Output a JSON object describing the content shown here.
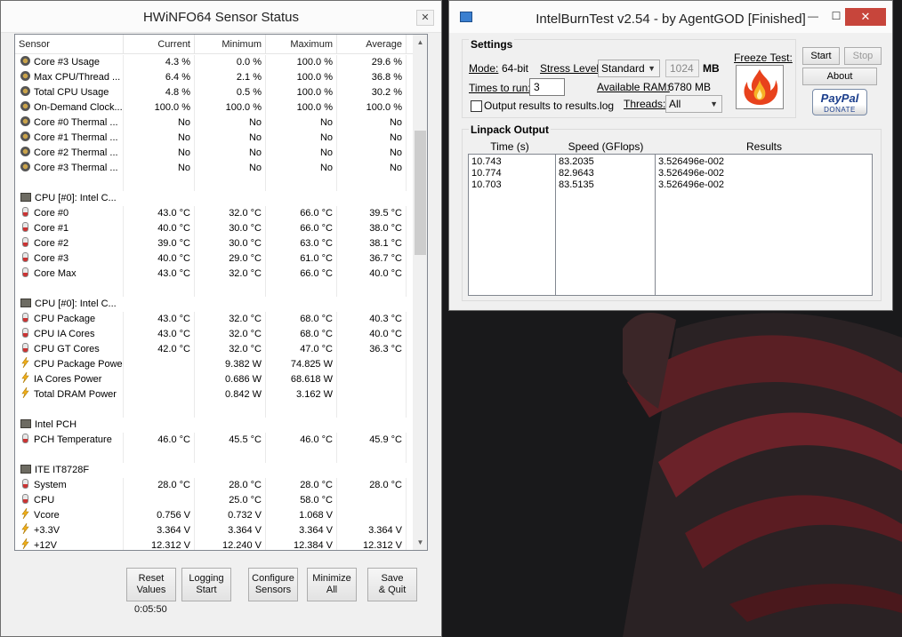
{
  "hwinfo": {
    "title": "HWiNFO64 Sensor Status",
    "close_glyph": "✕",
    "columns": [
      "Sensor",
      "Current",
      "Minimum",
      "Maximum",
      "Average"
    ],
    "rows": [
      {
        "icon": "clock",
        "cells": [
          "Core #3 Usage",
          "4.3 %",
          "0.0 %",
          "100.0 %",
          "29.6 %"
        ]
      },
      {
        "icon": "clock",
        "cells": [
          "Max CPU/Thread ...",
          "6.4 %",
          "2.1 %",
          "100.0 %",
          "36.8 %"
        ]
      },
      {
        "icon": "clock",
        "cells": [
          "Total CPU Usage",
          "4.8 %",
          "0.5 %",
          "100.0 %",
          "30.2 %"
        ]
      },
      {
        "icon": "clock",
        "cells": [
          "On-Demand Clock...",
          "100.0 %",
          "100.0 %",
          "100.0 %",
          "100.0 %"
        ]
      },
      {
        "icon": "clock",
        "cells": [
          "Core #0 Thermal ...",
          "No",
          "No",
          "No",
          "No"
        ]
      },
      {
        "icon": "clock",
        "cells": [
          "Core #1 Thermal ...",
          "No",
          "No",
          "No",
          "No"
        ]
      },
      {
        "icon": "clock",
        "cells": [
          "Core #2 Thermal ...",
          "No",
          "No",
          "No",
          "No"
        ]
      },
      {
        "icon": "clock",
        "cells": [
          "Core #3 Thermal ...",
          "No",
          "No",
          "No",
          "No"
        ]
      },
      {
        "icon": "",
        "cells": [
          "",
          "",
          "",
          "",
          ""
        ]
      },
      {
        "icon": "chip",
        "group": true,
        "cells": [
          "CPU [#0]: Intel C...",
          "",
          "",
          "",
          ""
        ]
      },
      {
        "icon": "therm",
        "cells": [
          "Core #0",
          "43.0 °C",
          "32.0 °C",
          "66.0 °C",
          "39.5 °C"
        ]
      },
      {
        "icon": "therm",
        "cells": [
          "Core #1",
          "40.0 °C",
          "30.0 °C",
          "66.0 °C",
          "38.0 °C"
        ]
      },
      {
        "icon": "therm",
        "cells": [
          "Core #2",
          "39.0 °C",
          "30.0 °C",
          "63.0 °C",
          "38.1 °C"
        ]
      },
      {
        "icon": "therm",
        "cells": [
          "Core #3",
          "40.0 °C",
          "29.0 °C",
          "61.0 °C",
          "36.7 °C"
        ]
      },
      {
        "icon": "therm",
        "cells": [
          "Core Max",
          "43.0 °C",
          "32.0 °C",
          "66.0 °C",
          "40.0 °C"
        ]
      },
      {
        "icon": "",
        "cells": [
          "",
          "",
          "",
          "",
          ""
        ]
      },
      {
        "icon": "chip",
        "group": true,
        "cells": [
          "CPU [#0]: Intel C...",
          "",
          "",
          "",
          ""
        ]
      },
      {
        "icon": "therm",
        "cells": [
          "CPU Package",
          "43.0 °C",
          "32.0 °C",
          "68.0 °C",
          "40.3 °C"
        ]
      },
      {
        "icon": "therm",
        "cells": [
          "CPU IA Cores",
          "43.0 °C",
          "32.0 °C",
          "68.0 °C",
          "40.0 °C"
        ]
      },
      {
        "icon": "therm",
        "cells": [
          "CPU GT Cores",
          "42.0 °C",
          "32.0 °C",
          "47.0 °C",
          "36.3 °C"
        ]
      },
      {
        "icon": "volt",
        "cells": [
          "CPU Package Power",
          "",
          "9.382 W",
          "74.825 W",
          ""
        ]
      },
      {
        "icon": "volt",
        "cells": [
          "IA Cores Power",
          "",
          "0.686 W",
          "68.618 W",
          ""
        ]
      },
      {
        "icon": "volt",
        "cells": [
          "Total DRAM Power",
          "",
          "0.842 W",
          "3.162 W",
          ""
        ]
      },
      {
        "icon": "",
        "cells": [
          "",
          "",
          "",
          "",
          ""
        ]
      },
      {
        "icon": "chip",
        "group": true,
        "cells": [
          "Intel PCH",
          "",
          "",
          "",
          ""
        ]
      },
      {
        "icon": "therm",
        "cells": [
          "PCH Temperature",
          "46.0 °C",
          "45.5 °C",
          "46.0 °C",
          "45.9 °C"
        ]
      },
      {
        "icon": "",
        "cells": [
          "",
          "",
          "",
          "",
          ""
        ]
      },
      {
        "icon": "chip",
        "group": true,
        "cells": [
          "ITE IT8728F",
          "",
          "",
          "",
          ""
        ]
      },
      {
        "icon": "therm",
        "cells": [
          "System",
          "28.0 °C",
          "28.0 °C",
          "28.0 °C",
          "28.0 °C"
        ]
      },
      {
        "icon": "therm",
        "cells": [
          "CPU",
          "",
          "25.0 °C",
          "58.0 °C",
          ""
        ]
      },
      {
        "icon": "volt",
        "cells": [
          "Vcore",
          "0.756 V",
          "0.732 V",
          "1.068 V",
          ""
        ]
      },
      {
        "icon": "volt",
        "cells": [
          "+3.3V",
          "3.364 V",
          "3.364 V",
          "3.364 V",
          "3.364 V"
        ]
      },
      {
        "icon": "volt",
        "cells": [
          "+12V",
          "12.312 V",
          "12.240 V",
          "12.384 V",
          "12.312 V"
        ]
      }
    ],
    "scroll_up_glyph": "▲",
    "scroll_down_glyph": "▼",
    "buttons": [
      {
        "line1": "Reset",
        "line2": "Values"
      },
      {
        "line1": "Logging",
        "line2": "Start"
      },
      {
        "line1": "Configure",
        "line2": "Sensors"
      },
      {
        "line1": "Minimize",
        "line2": "All"
      },
      {
        "line1": "Save",
        "line2": "& Quit"
      }
    ],
    "elapsed": "0:05:50"
  },
  "ibt": {
    "title": "IntelBurnTest v2.54 - by AgentGOD [Finished]",
    "min_glyph": "—",
    "max_glyph": "☐",
    "close_glyph": "✕",
    "settings": {
      "group_label": "Settings",
      "mode_label": "Mode:",
      "mode_value": "64-bit",
      "stress_label": "Stress Level:",
      "stress_value": "Standard",
      "memory_value": "1024",
      "memory_unit": "MB",
      "times_label": "Times to run:",
      "times_value": "3",
      "ram_label": "Available RAM:",
      "ram_value": "6780 MB",
      "output_label": "Output results to results.log",
      "threads_label": "Threads:",
      "threads_value": "All",
      "freeze_label": "Freeze Test:"
    },
    "start_label": "Start",
    "stop_label": "Stop",
    "about_label": "About",
    "paypal_word": "PayPal",
    "paypal_donate": "DONATE",
    "linpack": {
      "group_label": "Linpack Output",
      "headers": [
        "Time (s)",
        "Speed (GFlops)",
        "Results"
      ],
      "rows": [
        [
          "10.743",
          "83.2035",
          "3.526496e-002"
        ],
        [
          "10.774",
          "82.9643",
          "3.526496e-002"
        ],
        [
          "10.703",
          "83.5135",
          "3.526496e-002"
        ]
      ]
    }
  }
}
